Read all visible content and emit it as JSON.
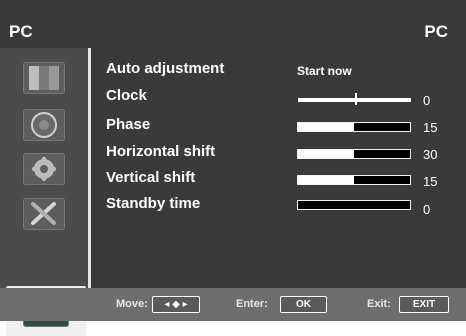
{
  "header": {
    "left_title": "PC",
    "right_title": "PC"
  },
  "menu": {
    "items": [
      {
        "label": "Auto adjustment",
        "action_text": "Start now"
      },
      {
        "label": "Clock",
        "value": "0",
        "slider": "center"
      },
      {
        "label": "Phase",
        "value": "15",
        "level_percent": 50
      },
      {
        "label": "Horizontal shift",
        "value": "30",
        "level_percent": 50
      },
      {
        "label": "Vertical shift",
        "value": "15",
        "level_percent": 50
      },
      {
        "label": "Standby time",
        "value": "0",
        "level_percent": 0
      }
    ]
  },
  "sidebar": {
    "icons": [
      {
        "name": "picture-icon"
      },
      {
        "name": "sound-icon"
      },
      {
        "name": "settings-gear-icon"
      },
      {
        "name": "tools-icon"
      },
      {
        "name": "pc-icon",
        "selected": true
      }
    ]
  },
  "footer": {
    "move_label": "Move:",
    "move_key": "◂ ◆ ▸",
    "enter_label": "Enter:",
    "enter_key": "OK",
    "exit_label": "Exit:",
    "exit_key": "EXIT"
  },
  "colors": {
    "background": "#3a3a3a",
    "sidebar": "#4b4b4b",
    "footer": "#6e6e6e",
    "text": "#ffffff"
  }
}
